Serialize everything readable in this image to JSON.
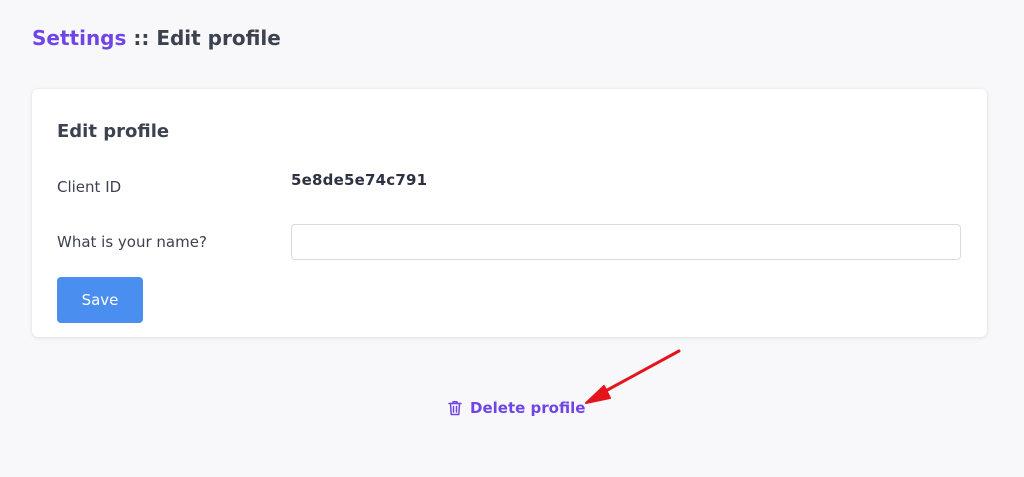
{
  "header": {
    "settings_link": "Settings",
    "separator": " :: ",
    "current_page": "Edit profile"
  },
  "card": {
    "title": "Edit profile",
    "client_id_label": "Client ID",
    "client_id_value": "5e8de5e74c791",
    "name_label": "What is your name?",
    "name_value": "",
    "name_placeholder": "",
    "save_label": "Save"
  },
  "actions": {
    "delete_label": "Delete profile",
    "delete_icon": "trash-icon"
  },
  "colors": {
    "accent": "#6f45e8",
    "primary_button": "#4a8ff0",
    "annotation_arrow": "#e3151b",
    "background": "#f8f8fa"
  }
}
